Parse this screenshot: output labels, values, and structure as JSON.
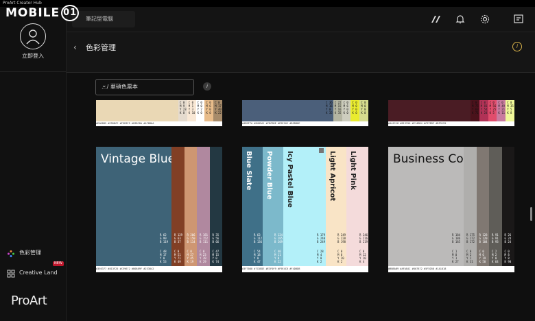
{
  "app": {
    "title": "ProArt Creator Hub",
    "watermark": "MOBILE01"
  },
  "sidebar": {
    "login_label": "立即登入",
    "items": [
      {
        "label": "色彩管理",
        "icon": "color-wheel-icon"
      },
      {
        "label": "Creative Land",
        "icon": "grid-icon",
        "badge": "NEW"
      }
    ],
    "brand": "ProArt"
  },
  "topbar": {
    "device_label": "筆記型電腦",
    "icons": [
      "proart-logo-icon",
      "bell-icon",
      "gear-icon",
      "feedback-icon"
    ]
  },
  "header": {
    "title": "色彩管理"
  },
  "main": {
    "dropdown_value": ".../ 華碩色票本"
  },
  "palettes_top": [
    {
      "stripes": [
        {
          "color": "#EAD8B5",
          "codes": ""
        },
        {
          "color": "#E5DBCE",
          "codes": "C 0\nM 9\nY 23\nK 8"
        },
        {
          "color": "#F9E8D5",
          "codes": "C 0\nM 1\nY 3\nK 10"
        },
        {
          "color": "#FFFFFF",
          "codes": "C 0\nM 0\nY 2\nK 0"
        },
        {
          "color": "#E8BC8A",
          "codes": "C 0\nM 6\nY 0\nK 0"
        },
        {
          "color": "#A78B6A",
          "codes": "C 0\nM 17\nY 40\nK 22"
        }
      ],
      "hex": "#EAD8B5 #E5DBCE #F9E8F5 #E8BC8A #A78B6A"
    },
    {
      "stripes": [
        {
          "color": "#4B5F7A",
          "codes": ""
        },
        {
          "color": "#4B5F7A",
          "codes": "C 36\nM 16\nY 0\nK 35"
        },
        {
          "color": "#B4B5A1",
          "codes": "C 22\nM 15\nY 16\nK 35"
        },
        {
          "color": "#CDCDBE",
          "codes": "C 0\nM 6\nY 0\nK 0"
        },
        {
          "color": "#E9EB2E",
          "codes": "C 0\nM 0\nY 0\nK 0"
        },
        {
          "color": "#D5DB8E",
          "codes": "C 0\nM 0\nY 0\nK 0"
        }
      ],
      "hex": "#4B5F7A #B4B5A1 #CDCDBE #E9E102 #D5DB8E"
    },
    {
      "stripes": [
        {
          "color": "#4A1C24",
          "codes": ""
        },
        {
          "color": "#4A121B",
          "codes": "C 0\nM 75\nY 63\nK 71"
        },
        {
          "color": "#B13256",
          "codes": "C 0\nM 81\nY 54\nK 24"
        },
        {
          "color": "#E14D6C",
          "codes": "C 0\nM 56\nY 25\nK 5"
        },
        {
          "color": "#C97B9F",
          "codes": "C 0\nM 49\nY 21\nK 11"
        },
        {
          "color": "#F0F899",
          "codes": "C 0\nM 35\nY 5\nK 8"
        }
      ],
      "hex": "#4A1218 #B13256 #E14DB4 #C97B9F #DF9195"
    }
  ],
  "palettes_big": [
    {
      "name": "Vintage Blues",
      "hex": "#3E6377 #813F25 #CE9672 #B0889F #233842",
      "stripes": [
        {
          "color": "#3E6377",
          "codes": "R 62\nG 99\nB 119",
          "cmyk": "C 48\nM 17\nY 0\nK 53"
        },
        {
          "color": "#813F25",
          "codes": "R 129\nG 63\nB 37",
          "cmyk": "C 0\nM 51\nY 71\nK 49"
        },
        {
          "color": "#CE9672",
          "codes": "R 206\nG 150\nB 114",
          "cmyk": "C 0\nM 27\nY 45\nK 19"
        },
        {
          "color": "#B0889F",
          "codes": "R 181\nG 152\nB 111",
          "cmyk": "C 0\nM 23\nY 39\nK 29"
        },
        {
          "color": "#233842",
          "codes": "R 35\nG 56\nB 66",
          "cmyk": "C 47\nM 15\nY 0\nK 74"
        }
      ]
    },
    {
      "name": "",
      "hex": "#3F7088 #7C8EDE #E3F0F9 #F9E4C6 #F4DBDB",
      "stripes": [
        {
          "color": "#3F7088",
          "label": "Blue Slate",
          "codes": "R 63\nG 112\nB 136",
          "cmyk": "C 54\nM 18\nY 0\nK 47"
        },
        {
          "color": "#7CB9CB",
          "label": "Powder Blue",
          "codes": "R 124\nG 185\nB 209",
          "cmyk": "C 40\nM 11\nY 0\nK 22"
        },
        {
          "color": "#B3F0F9",
          "label": "Icy Pastel Blue",
          "codes": "R 179\nG 240\nB 249",
          "cmyk": "C 28\nM 4\nY 0\nK 2"
        },
        {
          "color": "#F9E4C6",
          "label": "Light Apricot",
          "codes": "R 249\nG 228\nB 198",
          "cmyk": "C 0\nM 8\nY 20\nK 2"
        },
        {
          "color": "#F4DBDB",
          "label": "Light Pink",
          "codes": "R 246\nG 216\nB 219",
          "cmyk": "C 0\nM 12\nY 10\nK 4"
        }
      ]
    },
    {
      "name": "Business Cool Black",
      "hex": "#BBBAB9 #AFAEAC #807872 #5F5D58 #1A1818",
      "stripes": [
        {
          "color": "#BBBAB9",
          "codes": "R 184\nG 186\nB 185",
          "cmyk": "C 1\nM 0\nY 1\nK 27"
        },
        {
          "color": "#AFAEAC",
          "codes": "R 175\nG 172\nB 172",
          "cmyk": "C 0\nM 2\nY 2\nK 31"
        },
        {
          "color": "#807872",
          "codes": "R 128\nG 120\nB 104",
          "cmyk": "C 0\nM 6\nY 19\nK 50"
        },
        {
          "color": "#5F5D58",
          "codes": "R 91\nG 91\nB 93",
          "cmyk": "C 2\nM 2\nY 0\nK 64"
        },
        {
          "color": "#1A1818",
          "codes": "R 26\nG 24\nB 24",
          "cmyk": "C 0\nM 8\nY 8\nK 90"
        }
      ]
    }
  ]
}
